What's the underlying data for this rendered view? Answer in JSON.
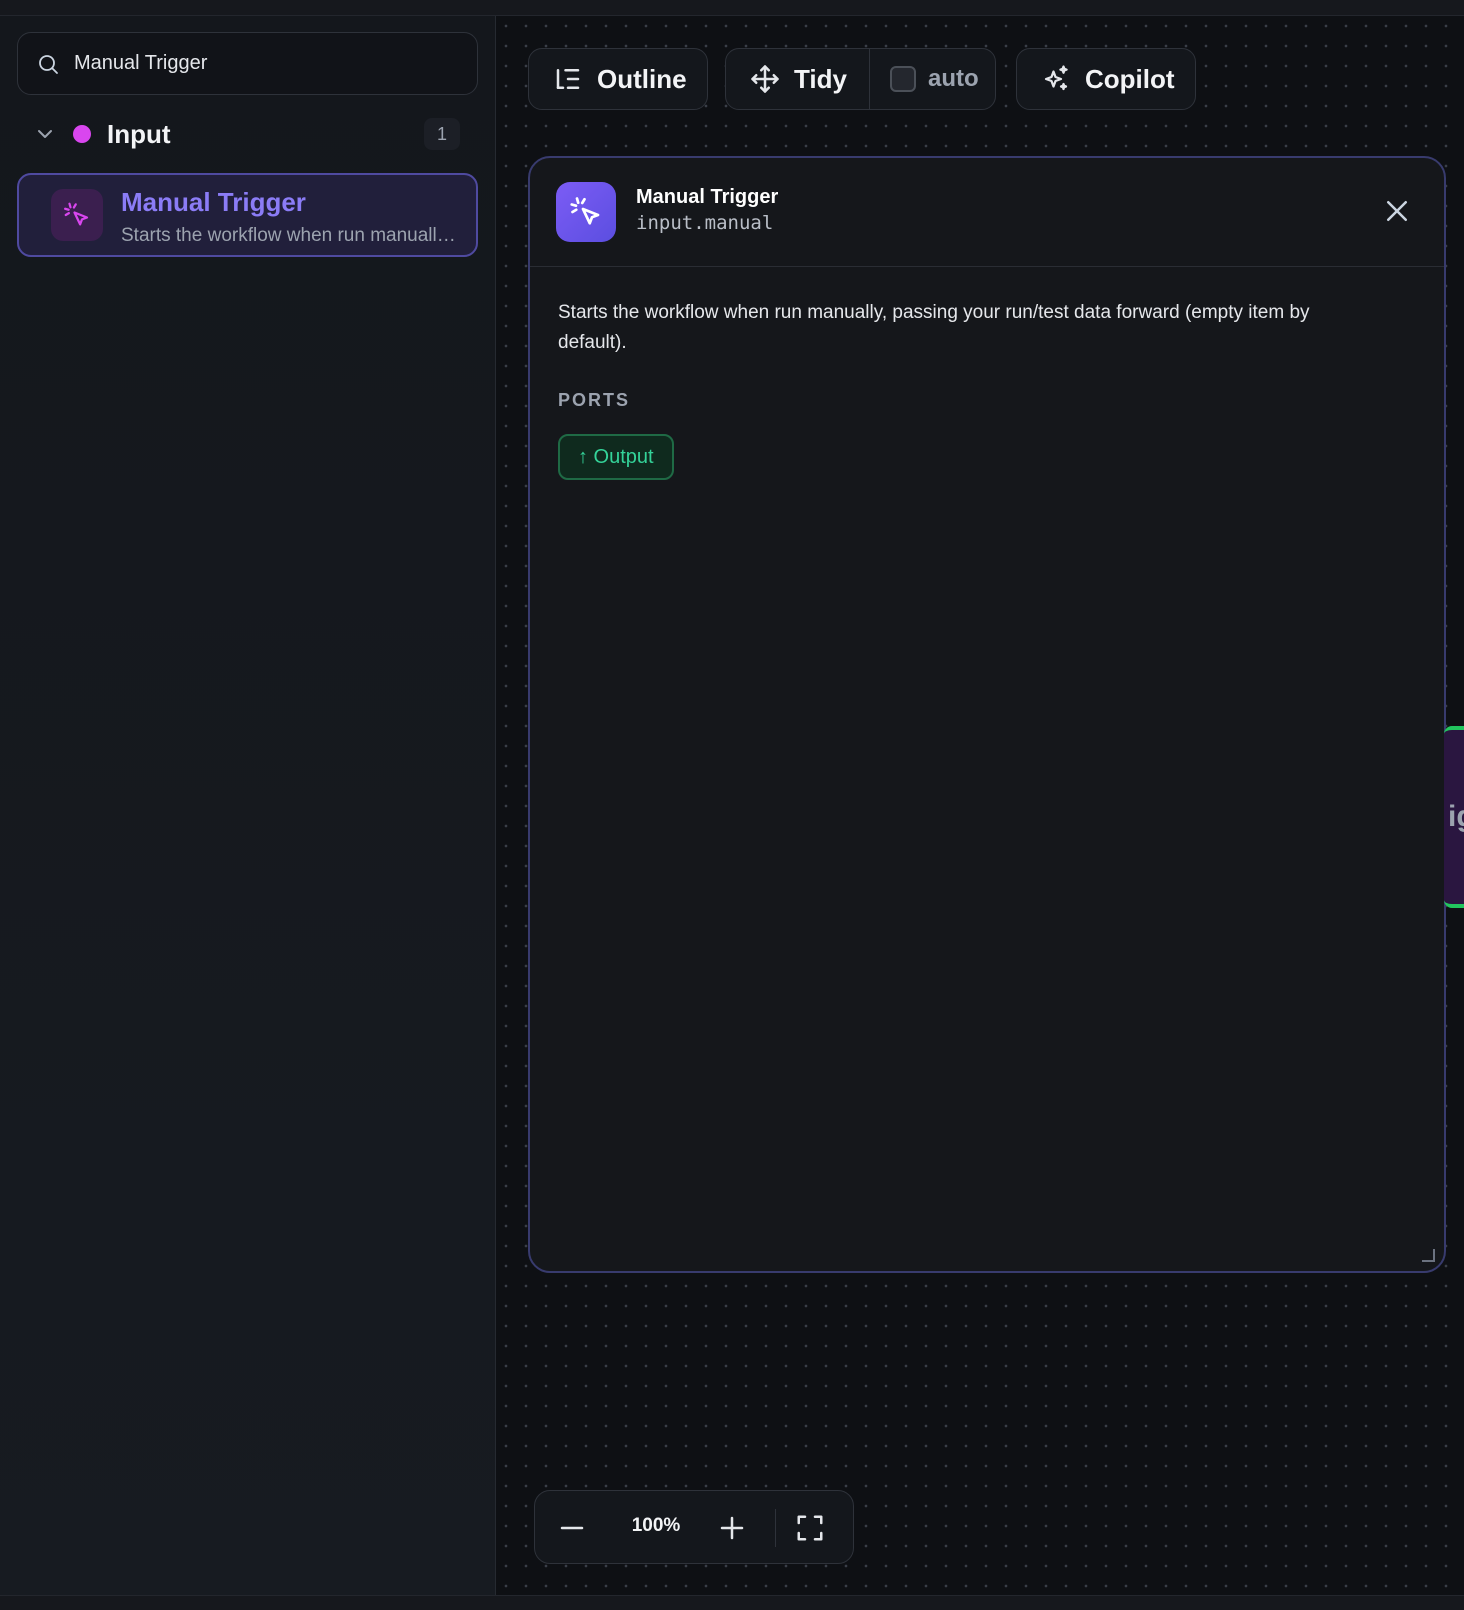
{
  "sidebar": {
    "search": {
      "value": "Manual Trigger",
      "icon": "search-icon"
    },
    "group": {
      "label": "Input",
      "count": "1",
      "dot_color": "#d946ef"
    },
    "node": {
      "title": "Manual Trigger",
      "description": "Starts the workflow when run manually, passing your run/test data forward (empty item by default).",
      "icon": "cursor-click-icon"
    }
  },
  "toolbar": {
    "outline_label": "Outline",
    "tidy_label": "Tidy",
    "auto_label": "auto",
    "auto_checked": false,
    "copilot_label": "Copilot"
  },
  "panel": {
    "title": "Manual Trigger",
    "type": "input.manual",
    "description": "Starts the workflow when run manually, passing your run/test data forward (empty item by default).",
    "ports_label": "PORTS",
    "ports": [
      "↑ Output"
    ]
  },
  "canvas": {
    "edge_node_text": "ig"
  },
  "zoom": {
    "level": "100%"
  },
  "colors": {
    "accent": "#8b7cf6",
    "port": "#34d399",
    "node_dot": "#d946ef"
  }
}
